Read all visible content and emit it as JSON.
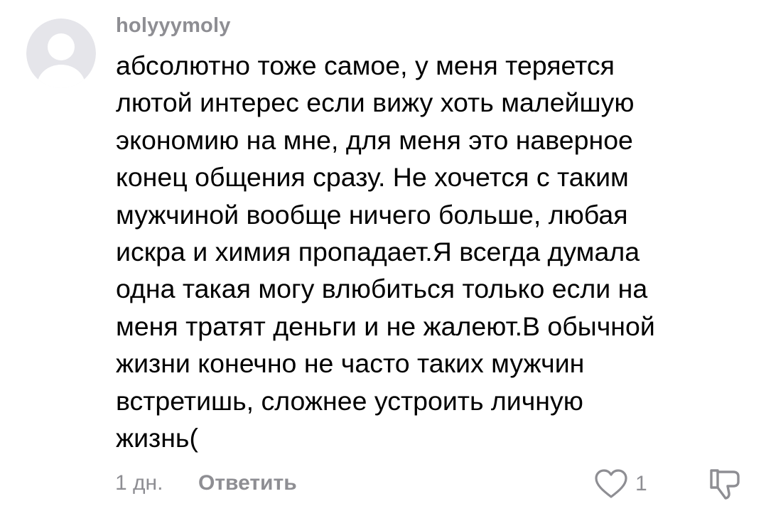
{
  "comment": {
    "username": "holyyymoly",
    "text_lines": [
      "абсолютно тоже самое, у меня теряется",
      "лютой интерес если вижу хоть малейшую",
      "экономию на мне, для меня это наверное",
      "конец общения сразу. Не хочется с таким",
      "мужчиной вообще ничего больше, любая",
      "искра и химия пропадает.Я всегда думала",
      "одна такая могу влюбиться только если на",
      "меня тратят деньги и не жалеют.В обычной",
      "жизни конечно не часто таких мужчин",
      "встретишь, сложнее устроить личную",
      "жизнь("
    ],
    "time_ago": "1 дн.",
    "reply_label": "Ответить",
    "like_count": "1"
  },
  "icons": {
    "avatar": "default-avatar-icon",
    "like": "heart-outline-icon",
    "dislike": "thumbs-down-outline-icon"
  },
  "colors": {
    "text": "#000000",
    "muted": "#8e8e93",
    "avatar_bg": "#e5e5ea",
    "avatar_figure": "#ffffff"
  }
}
